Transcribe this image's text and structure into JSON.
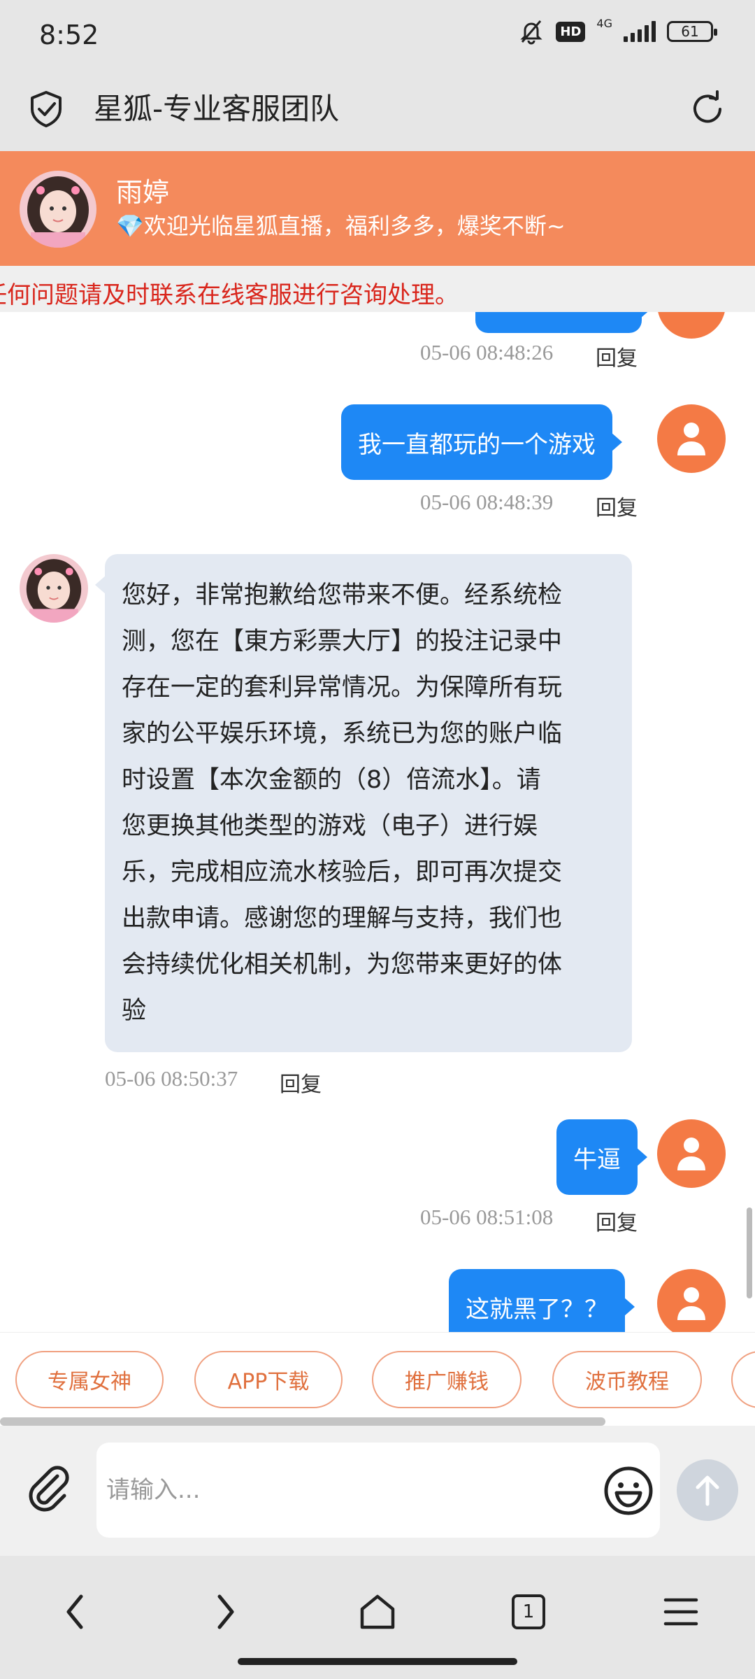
{
  "status_bar": {
    "time": "8:52",
    "hd": "HD",
    "network": "4G",
    "battery": "61"
  },
  "header": {
    "title": "星狐-专业客服团队"
  },
  "agent": {
    "name": "雨婷",
    "welcome": "💎欢迎光临星狐直播，福利多多，爆奖不断~"
  },
  "notice": {
    "text": "任何问题请及时联系在线客服进行咨询处理。"
  },
  "messages": [
    {
      "from": "user",
      "time": "05-06 08:48:26",
      "reply_label": "回复"
    },
    {
      "from": "user",
      "text": "我一直都玩的一个游戏",
      "time": "05-06 08:48:39",
      "reply_label": "回复"
    },
    {
      "from": "agent",
      "lines": [
        "您好，非常抱歉给您带来不便。经系统检",
        "测，您在【東方彩票大厅】的投注记录中",
        "存在一定的套利异常情况。为保障所有玩",
        "家的公平娱乐环境，系统已为您的账户临",
        "时设置【本次金额的（8）倍流水】。请",
        "您更换其他类型的游戏（电子）进行娱",
        "乐，完成相应流水核验后，即可再次提交",
        "出款申请。感谢您的理解与支持，我们也",
        "会持续优化相关机制，为您带来更好的体",
        "验"
      ],
      "time": "05-06 08:50:37",
      "reply_label": "回复"
    },
    {
      "from": "user",
      "text": "牛逼",
      "time": "05-06 08:51:08",
      "reply_label": "回复"
    },
    {
      "from": "user",
      "text": "这就黑了？？"
    }
  ],
  "quick_actions": [
    "专属女神",
    "APP下载",
    "推广赚钱",
    "波币教程"
  ],
  "input": {
    "placeholder": "请输入..."
  },
  "nav": {
    "tabs_count": "1"
  },
  "colors": {
    "accent": "#f48a5c",
    "user_bubble": "#1e88f5",
    "agent_bubble": "#e3e9f2",
    "notice": "#d9261c"
  }
}
